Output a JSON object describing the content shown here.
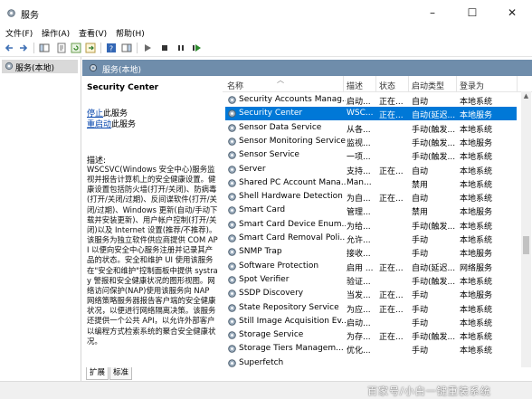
{
  "window": {
    "title": "服务",
    "minimize": "–",
    "maximize": "☐",
    "close": "✕"
  },
  "menu": [
    "文件(F)",
    "操作(A)",
    "查看(V)",
    "帮助(H)"
  ],
  "tree": {
    "root_label": "服务(本地)"
  },
  "pane": {
    "header": "服务(本地)"
  },
  "detail": {
    "service_name": "Security Center",
    "stop_link": "停止",
    "stop_suffix": "此服务",
    "restart_link": "重启动",
    "restart_suffix": "此服务",
    "desc_label": "描述:",
    "desc_text": "WSCSVC(Windows 安全中心)服务监视并报告计算机上的安全健康设置。健康设置包括防火墙(打开/关闭)、防病毒(打开/关闭/过期)、反间谍软件(打开/关闭/过期)、Windows 更新(自动/手动下载并安装更新)、用户帐户控制(打开/关闭)以及 Internet 设置(推荐/不推荐)。该服务为独立软件供应商提供 COM API 以便向安全中心服务注册并记录其产品的状态。安全和维护 UI 使用该服务在\"安全和维护\"控制面板中提供 systray 警报和安全健康状况的图形视图。网络访问保护(NAP)使用该服务向 NAP 网络策略服务器报告客户端的安全健康状况，以便进行网络隔离决策。该服务还提供一个公共 API，以允许外部客户以编程方式检索系统的聚合安全健康状况。"
  },
  "columns": {
    "name": "名称",
    "description": "描述",
    "status": "状态",
    "startup": "启动类型",
    "logon": "登录为"
  },
  "rows": [
    {
      "name": "Security Accounts Manag...",
      "desc": "启动...",
      "status": "正在...",
      "startup": "自动",
      "logon": "本地系统"
    },
    {
      "name": "Security Center",
      "desc": "WSC...",
      "status": "正在...",
      "startup": "自动(延迟...",
      "logon": "本地服务"
    },
    {
      "name": "Sensor Data Service",
      "desc": "从各...",
      "status": "",
      "startup": "手动(触发...",
      "logon": "本地系统"
    },
    {
      "name": "Sensor Monitoring Service",
      "desc": "监视...",
      "status": "",
      "startup": "手动(触发...",
      "logon": "本地服务"
    },
    {
      "name": "Sensor Service",
      "desc": "一项...",
      "status": "",
      "startup": "手动(触发...",
      "logon": "本地系统"
    },
    {
      "name": "Server",
      "desc": "支持...",
      "status": "正在...",
      "startup": "自动",
      "logon": "本地系统"
    },
    {
      "name": "Shared PC Account Mana...",
      "desc": "Man...",
      "status": "",
      "startup": "禁用",
      "logon": "本地系统"
    },
    {
      "name": "Shell Hardware Detection",
      "desc": "为自...",
      "status": "正在...",
      "startup": "自动",
      "logon": "本地系统"
    },
    {
      "name": "Smart Card",
      "desc": "管理...",
      "status": "",
      "startup": "禁用",
      "logon": "本地服务"
    },
    {
      "name": "Smart Card Device Enum...",
      "desc": "为给...",
      "status": "",
      "startup": "手动(触发...",
      "logon": "本地系统"
    },
    {
      "name": "Smart Card Removal Poli...",
      "desc": "允许...",
      "status": "",
      "startup": "手动",
      "logon": "本地系统"
    },
    {
      "name": "SNMP Trap",
      "desc": "接收...",
      "status": "",
      "startup": "手动",
      "logon": "本地服务"
    },
    {
      "name": "Software Protection",
      "desc": "启用 ...",
      "status": "正在...",
      "startup": "自动(延迟...",
      "logon": "网络服务"
    },
    {
      "name": "Spot Verifier",
      "desc": "验证...",
      "status": "",
      "startup": "手动(触发...",
      "logon": "本地系统"
    },
    {
      "name": "SSDP Discovery",
      "desc": "当发...",
      "status": "正在...",
      "startup": "手动",
      "logon": "本地服务"
    },
    {
      "name": "State Repository Service",
      "desc": "为应...",
      "status": "正在...",
      "startup": "手动",
      "logon": "本地系统"
    },
    {
      "name": "Still Image Acquisition Ev...",
      "desc": "启动...",
      "status": "",
      "startup": "手动",
      "logon": "本地系统"
    },
    {
      "name": "Storage Service",
      "desc": "为存...",
      "status": "正在...",
      "startup": "手动(触发...",
      "logon": "本地系统"
    },
    {
      "name": "Storage Tiers Managem...",
      "desc": "优化...",
      "status": "",
      "startup": "手动",
      "logon": "本地系统"
    },
    {
      "name": "Superfetch",
      "desc": "",
      "status": "",
      "startup": "",
      "logon": ""
    }
  ],
  "selected_row": 1,
  "tabs": [
    "扩展",
    "标准"
  ],
  "watermark": "百家号/小白一键重装系统",
  "colors": {
    "accent": "#0078d7",
    "pane_header": "#6f8dab",
    "link": "#0645ad"
  }
}
